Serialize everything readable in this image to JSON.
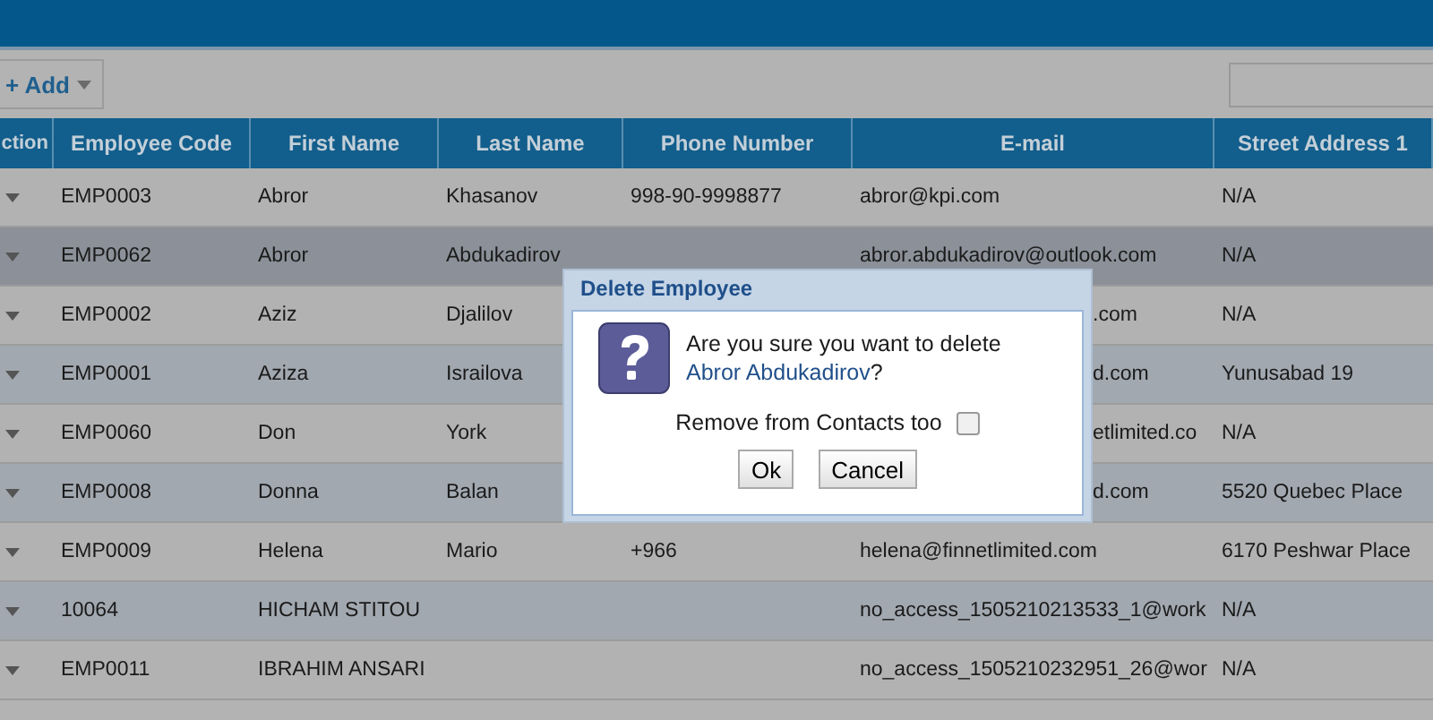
{
  "toolbar": {
    "add_button": "+ Add"
  },
  "table": {
    "columns": [
      "ction",
      "Employee Code",
      "First Name",
      "Last Name",
      "Phone Number",
      "E-mail",
      "Street Address 1"
    ],
    "rows": [
      {
        "selected": false,
        "cells": [
          "",
          "EMP0003",
          "Abror",
          "Khasanov",
          "998-90-9998877",
          "abror@kpi.com",
          "N/A"
        ]
      },
      {
        "selected": true,
        "cells": [
          "",
          "EMP0062",
          "Abror",
          "Abdukadirov",
          "",
          "abror.abdukadirov@outlook.com",
          "N/A"
        ]
      },
      {
        "selected": false,
        "cells": [
          "",
          "EMP0002",
          "Aziz",
          "Djalilov",
          "",
          ".com",
          "N/A"
        ]
      },
      {
        "selected": false,
        "cells": [
          "",
          "EMP0001",
          "Aziza",
          "Israilova",
          "",
          "d.com",
          "Yunusabad 19"
        ]
      },
      {
        "selected": false,
        "cells": [
          "",
          "EMP0060",
          "Don",
          "York",
          "",
          "etlimited.co",
          "N/A"
        ]
      },
      {
        "selected": false,
        "cells": [
          "",
          "EMP0008",
          "Donna",
          "Balan",
          "",
          "d.com",
          "5520 Quebec Place"
        ]
      },
      {
        "selected": false,
        "cells": [
          "",
          "EMP0009",
          "Helena",
          "Mario",
          "+966",
          "helena@finnetlimited.com",
          "6170 Peshwar Place"
        ]
      },
      {
        "selected": false,
        "cells": [
          "",
          "10064",
          "HICHAM STITOU",
          "",
          "",
          "no_access_1505210213533_1@work",
          "N/A"
        ]
      },
      {
        "selected": false,
        "cells": [
          "",
          "EMP0011",
          "IBRAHIM ANSARI",
          "",
          "",
          "no_access_1505210232951_26@wor",
          "N/A"
        ]
      }
    ]
  },
  "dialog": {
    "title": "Delete Employee",
    "message": "Are you sure you want to delete **Abror Abdukadirov**?",
    "checkbox": {
      "label": "Remove from Contacts too",
      "checked": false
    },
    "buttons": [
      "Ok",
      "Cancel"
    ]
  }
}
